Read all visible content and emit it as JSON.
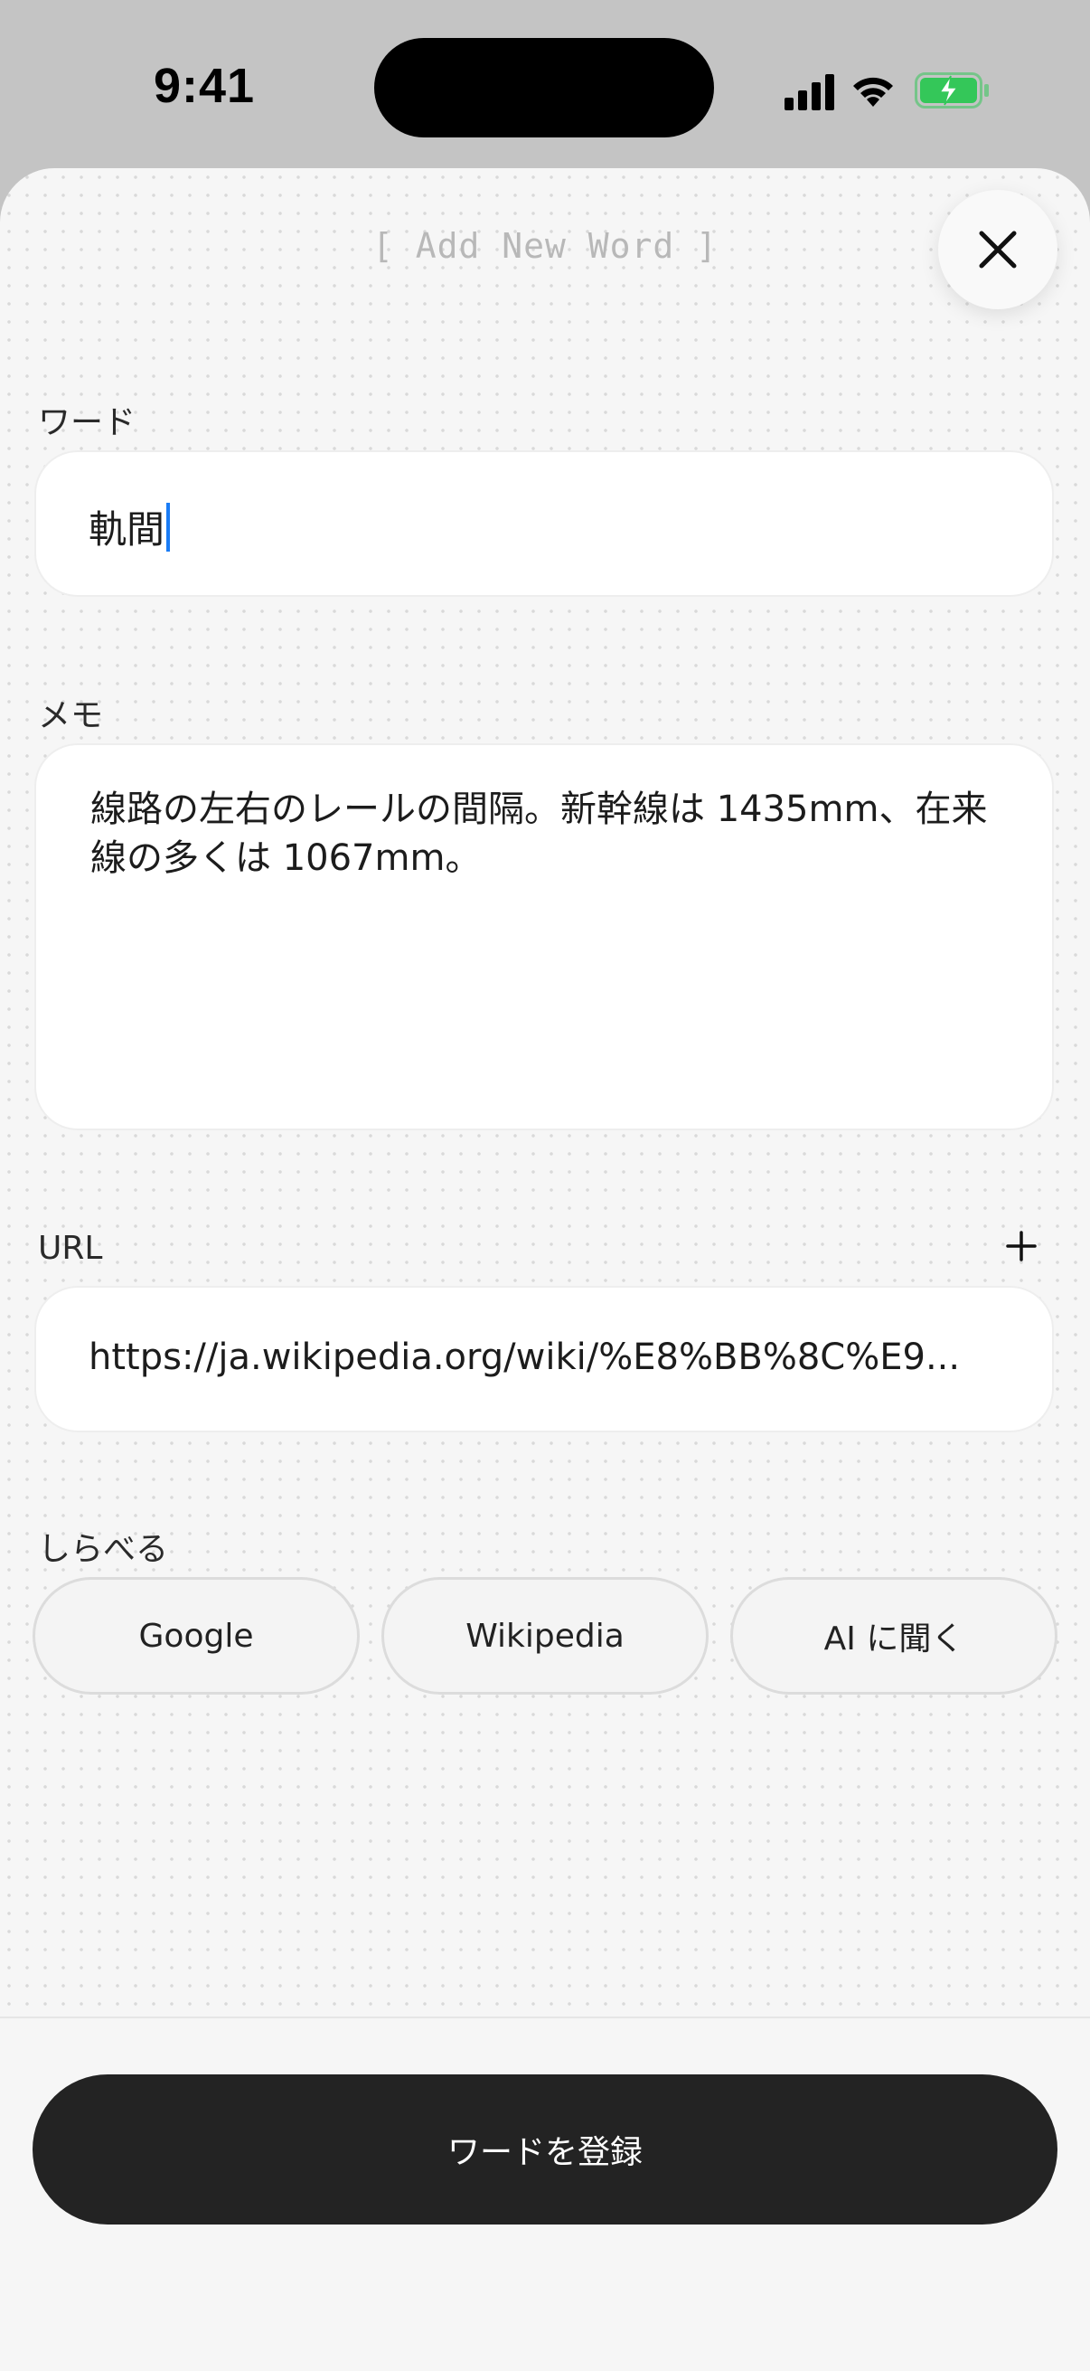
{
  "status_bar": {
    "time": "9:41",
    "icons": [
      "cellular-signal-icon",
      "wifi-icon",
      "battery-charging-icon"
    ],
    "battery_color": "#34c759"
  },
  "sheet": {
    "title": "[ Add New Word ]",
    "close_icon": "close-icon"
  },
  "word": {
    "label": "ワード",
    "value": "軌間"
  },
  "memo": {
    "label": "メモ",
    "value": "線路の左右のレールの間隔。新幹線は 1435mm、在来線の多くは 1067mm。"
  },
  "url": {
    "label": "URL",
    "add_icon": "plus-icon",
    "value": "https://ja.wikipedia.org/wiki/%E8%BB%8C%E9..."
  },
  "search": {
    "label": "しらべる",
    "buttons": [
      {
        "label": "Google"
      },
      {
        "label": "Wikipedia"
      },
      {
        "label": "AI に聞く"
      }
    ]
  },
  "submit": {
    "label": "ワードを登録"
  },
  "colors": {
    "caret": "#1a7cf5",
    "primary_button": "#232323",
    "background": "#f6f6f6"
  }
}
